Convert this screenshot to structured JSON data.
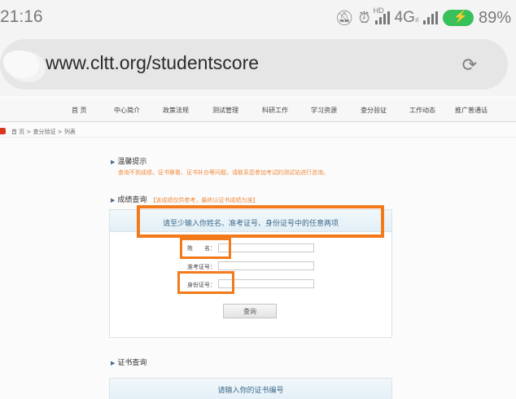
{
  "status_bar": {
    "time": "21:16",
    "hd_label": "HD",
    "network_label": "4G",
    "network_sub": "ıl",
    "battery_percent": "89%",
    "icons": [
      "mute-icon",
      "alarm-icon",
      "signal-icon",
      "battery-icon"
    ]
  },
  "browser": {
    "url": "www.cltt.org/studentscore",
    "reload_icon": "⟳"
  },
  "site": {
    "nav": [
      "首 页",
      "中心简介",
      "政策法规",
      "测试管理",
      "科研工作",
      "学习资源",
      "查分验证",
      "工作动态",
      "推广普通话"
    ],
    "breadcrumb": "首 页 > 查分验证 > 列表",
    "notice_title": "温馨提示",
    "notice_text": "查询不到成绩，证书察看、证书补办等问题，请联系您参加考试的测试站进行咨询。",
    "query_title": "成绩查询",
    "query_hint": "【该成绩仅供参考，最终以证书成绩为准】",
    "query_instruction": "请至少输入你姓名、准考证号、身份证号中的任意两项",
    "fields": {
      "name_label": "姓　　名：",
      "exam_label": "准考证号：",
      "id_label": "身份证号："
    },
    "query_button": "查询",
    "cert_title": "证书查询",
    "cert_instruction": "请输入你的证书编号"
  },
  "colors": {
    "annotation": "#f27a1b",
    "accent_text": "#f08a3c",
    "panel_title": "#3f6a8a",
    "battery": "#38c15a"
  }
}
